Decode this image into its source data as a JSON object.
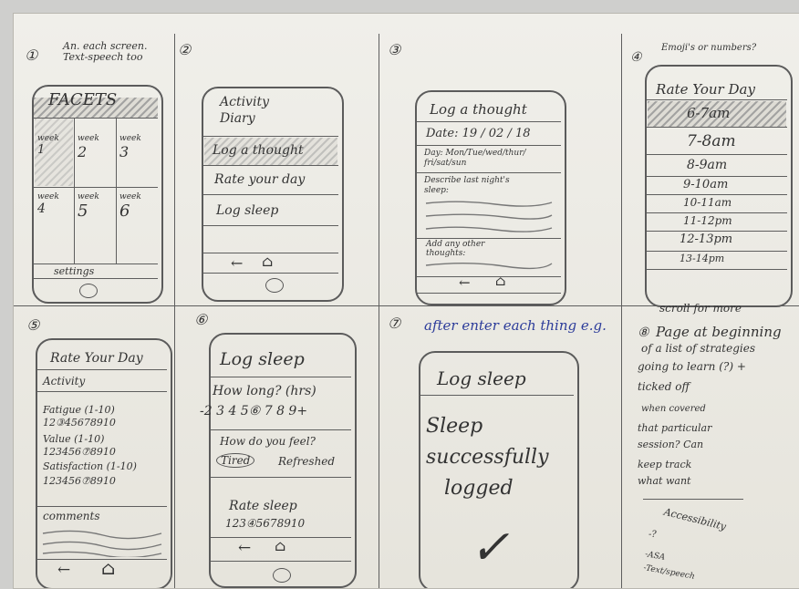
{
  "panel1": {
    "number": "①",
    "note": "An. each screen. Text-speech too",
    "title": "FACETS",
    "weeks": [
      [
        "week 1",
        "week 2",
        "week 3"
      ],
      [
        "week 4",
        "week 5",
        "week 6"
      ]
    ],
    "week_word": "week",
    "week_numbers": [
      "1",
      "2",
      "3",
      "4",
      "5",
      "6"
    ],
    "footer": "settings"
  },
  "panel2": {
    "number": "②",
    "title_line1": "Activity",
    "title_line2": "Diary",
    "items": [
      "Log a thought",
      "Rate your day",
      "Log sleep"
    ]
  },
  "panel3": {
    "number": "③",
    "title": "Log a thought",
    "date": "Date: 19 / 02 / 18",
    "day_line1": "Day: Mon/Tue/wed/thur/",
    "day_line2": "fri/sat/sun",
    "describe_line1": "Describe last night's",
    "describe_line2": "sleep:",
    "add_line1": "Add any other",
    "add_line2": "thoughts:"
  },
  "panel4": {
    "number": "④",
    "note": "Emoji's or numbers?",
    "title": "Rate Your Day",
    "times": [
      "6-7am",
      "7-8am",
      "8-9am",
      "9-10am",
      "10-11am",
      "11-12pm",
      "12-13pm",
      "13-14pm"
    ],
    "footer": "scroll for more"
  },
  "panel5": {
    "number": "⑤",
    "title": "Rate Your Day",
    "activity": "Activity",
    "fatigue": "Fatigue (1-10)",
    "fatigue_scale": "12③45678910",
    "value": "Value (1-10)",
    "value_scale": "123456⑦8910",
    "satisfaction": "Satisfaction (1-10)",
    "satisfaction_scale": "123456⑦8910",
    "comments": "comments"
  },
  "panel6": {
    "number": "⑥",
    "title": "Log sleep",
    "how_long": "How long? (hrs)",
    "hours_scale": "-2 3 4 5⑥ 7 8 9+",
    "feel": "How do you feel?",
    "tired": "Tired",
    "refreshed": "Refreshed",
    "rate": "Rate sleep",
    "rate_scale": "123④5678910"
  },
  "panel7": {
    "number": "⑦",
    "note": "after enter each thing e.g.",
    "title": "Log sleep",
    "msg_line1": "Sleep",
    "msg_line2": "successfully",
    "msg_line3": "logged",
    "check": "✓"
  },
  "panel8": {
    "number": "⑧",
    "lines": [
      "Page at beginning",
      "of a list of strategies",
      "going to learn (?) +",
      "ticked off",
      "when covered",
      "that particular",
      "session? Can",
      "keep track",
      "what want"
    ],
    "extra_lines": [
      "Accessibility",
      "-?",
      "-ASA",
      "-Text/speech"
    ]
  },
  "icons": {
    "back": "←",
    "home": "⌂"
  }
}
